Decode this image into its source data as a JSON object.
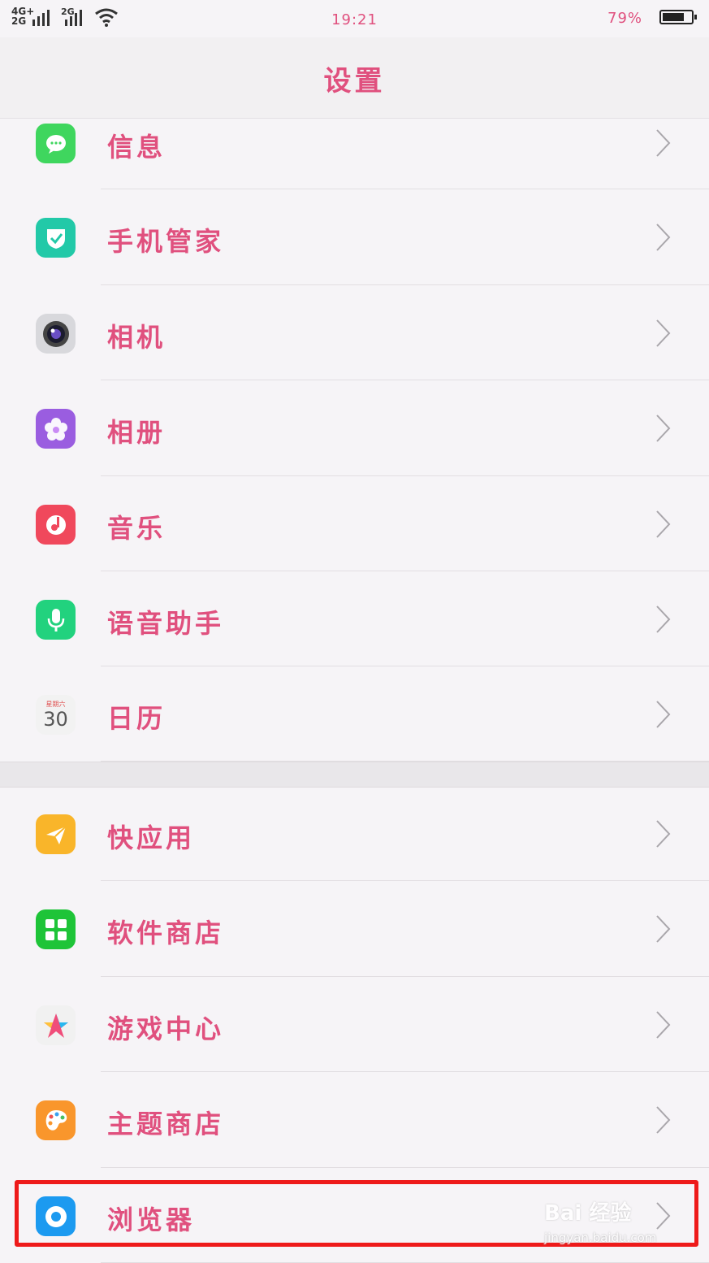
{
  "status": {
    "signal_1": "4G+\n2G",
    "signal_2": "2G",
    "time": "19:21",
    "battery_pct": "79%",
    "battery_level": 0.79
  },
  "header": {
    "title": "设置"
  },
  "items": [
    {
      "label": "信息",
      "icon": "message-icon",
      "color": "#3fd65e"
    },
    {
      "label": "手机管家",
      "icon": "shield-icon",
      "color": "#22c9a8"
    },
    {
      "label": "相机",
      "icon": "camera-icon",
      "color": "#d8d8dc"
    },
    {
      "label": "相册",
      "icon": "flower-icon",
      "color": "#9a5de0"
    },
    {
      "label": "音乐",
      "icon": "music-icon",
      "color": "#f0485c"
    },
    {
      "label": "语音助手",
      "icon": "microphone-icon",
      "color": "#22d27e"
    },
    {
      "label": "日历",
      "icon": "calendar-icon",
      "color": "#f2f2f2",
      "icon_text_top": "星期六",
      "icon_text_day": "30"
    },
    {
      "label": "快应用",
      "icon": "paper-plane-icon",
      "color": "#f9b52a"
    },
    {
      "label": "软件商店",
      "icon": "app-grid-icon",
      "color": "#1ec438"
    },
    {
      "label": "游戏中心",
      "icon": "star-icon",
      "color": "#f1f1f1"
    },
    {
      "label": "主题商店",
      "icon": "palette-icon",
      "color": "#f9962c"
    },
    {
      "label": "浏览器",
      "icon": "browser-icon",
      "color": "#1c9af0"
    }
  ],
  "watermark": {
    "brand": "Bai 经验",
    "url": "jingyan.baidu.com"
  }
}
